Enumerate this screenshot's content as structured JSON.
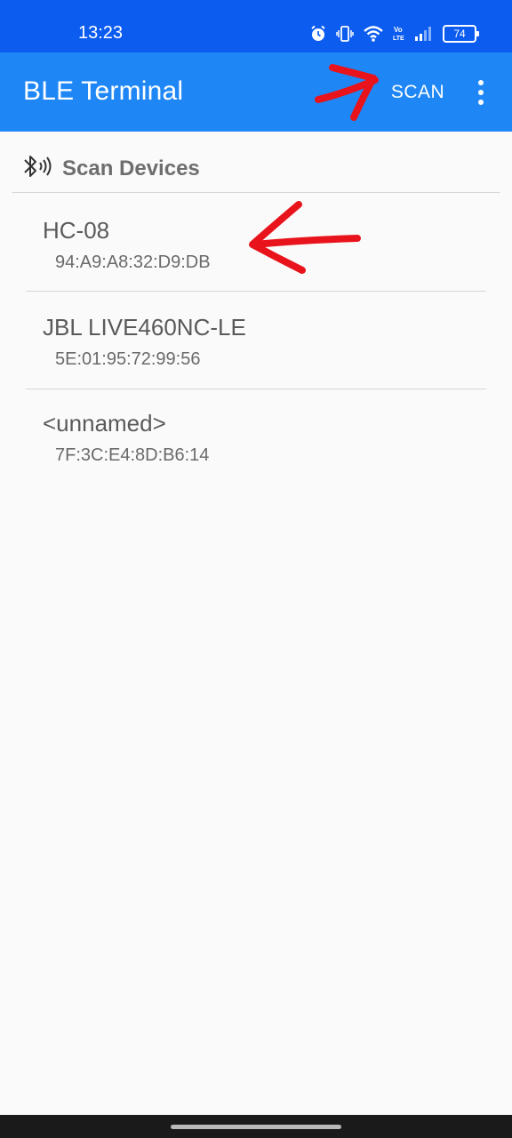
{
  "status": {
    "time": "13:23",
    "battery": "74",
    "network_label": "Vo LTE"
  },
  "appbar": {
    "title": "BLE Terminal",
    "scan_label": "SCAN"
  },
  "section": {
    "title": "Scan Devices"
  },
  "devices": [
    {
      "name": "HC-08",
      "address": "94:A9:A8:32:D9:DB"
    },
    {
      "name": "JBL LIVE460NC-LE",
      "address": "5E:01:95:72:99:56"
    },
    {
      "name": "<unnamed>",
      "address": "7F:3C:E4:8D:B6:14"
    }
  ],
  "colors": {
    "status_bar": "#0c5cf0",
    "app_bar": "#1f87f5",
    "background": "#fafafa",
    "annotation": "#e8131b"
  },
  "icons": {
    "status": [
      "alarm-icon",
      "vibrate-icon",
      "wifi-icon",
      "volte-icon",
      "signal-icon",
      "battery-icon"
    ],
    "section": "bluetooth-scan-icon",
    "menu": "more-vert-icon"
  }
}
